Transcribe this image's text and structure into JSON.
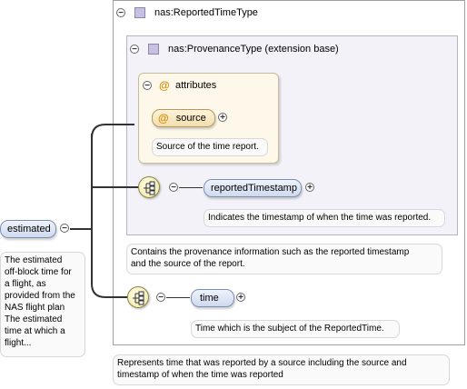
{
  "root": {
    "label": "estimated",
    "doc": [
      "The estimated",
      "off-block time for",
      "a flight, as",
      "provided from the",
      "NAS flight plan",
      "The estimated",
      "time at which a",
      "flight..."
    ]
  },
  "reported_time_type": {
    "title": "nas:ReportedTimeType",
    "doc": [
      "Represents time that was reported by a source including the source and",
      "timestamp of when the time was reported"
    ]
  },
  "provenance_type": {
    "title": "nas:ProvenanceType (extension base)",
    "doc": [
      "Contains the provenance information such as the reported timestamp",
      "and the source of the report."
    ]
  },
  "attributes": {
    "title": "attributes",
    "source": {
      "label": "source",
      "doc": "Source of the time report."
    }
  },
  "reported_timestamp": {
    "label": "reportedTimestamp",
    "doc": "Indicates the timestamp of when the time was reported."
  },
  "time": {
    "label": "time",
    "doc": "Time which is the subject of the ReportedTime."
  },
  "glyphs": {
    "collapse": "⊖",
    "expand": "+",
    "at": "@"
  },
  "colors": {
    "element_pill": "#cfdaee",
    "attribute_pill": "#f2dfb0",
    "type_icon": "#c8c0e0",
    "connector": "#333333"
  }
}
